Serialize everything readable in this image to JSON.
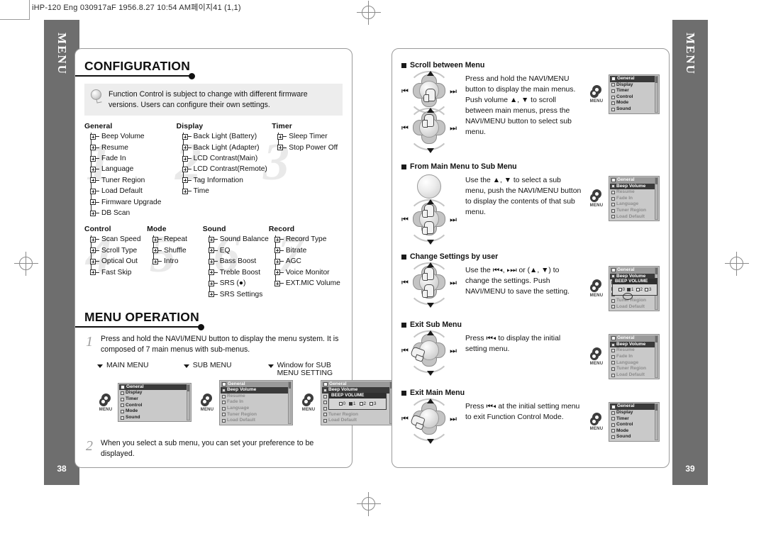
{
  "print_header": "iHP-120 Eng 030917aF  1956.8.27 10:54 AM페이지41 (1,1)",
  "tabs": {
    "left": {
      "label": "MENU",
      "page": "38"
    },
    "right": {
      "label": "MENU",
      "page": "39"
    }
  },
  "left_page": {
    "section1": {
      "title": "CONFIGURATION",
      "tip": "Function Control is subject to change with different firmware versions. Users can configure their own settings.",
      "tree_row1": [
        {
          "head": "General",
          "items": [
            "Beep Volume",
            "Resume",
            "Fade In",
            "Language",
            "Tuner Region",
            "Load Default",
            "Firmware Upgrade",
            "DB  Scan"
          ]
        },
        {
          "head": "Display",
          "items": [
            "Back Light (Battery)",
            "Back Light (Adapter)",
            "LCD Contrast(Main)",
            "LCD Contrast(Remote)",
            "Tag Information",
            "Time"
          ]
        },
        {
          "head": "Timer",
          "items": [
            "Sleep Timer",
            "Stop Power Off"
          ]
        }
      ],
      "tree_row2": [
        {
          "head": "Control",
          "items": [
            "Scan Speed",
            "Scroll Type",
            "Optical Out",
            "Fast Skip"
          ]
        },
        {
          "head": "Mode",
          "items": [
            "Repeat",
            "Shuffle",
            "Intro"
          ]
        },
        {
          "head": "Sound",
          "items": [
            "Sound Balance",
            "EQ",
            "Bass Boost",
            "Treble Boost",
            "SRS (●)",
            "SRS Settings"
          ]
        },
        {
          "head": "Record",
          "items": [
            "Record Type",
            "Bitrate",
            "AGC",
            "Voice Monitor",
            "EXT.MIC Volume"
          ]
        }
      ],
      "watermarks": [
        "1",
        "2",
        "3",
        "4",
        "5",
        "6",
        "7"
      ]
    },
    "section2": {
      "title": "MENU OPERATION",
      "step1_num": "1",
      "step1_text": "Press and hold the NAVI/MENU button to display the menu system. It is composed of 7 main menus with sub-menus.",
      "captions": [
        "MAIN MENU",
        "SUB MENU",
        "Window for SUB MENU SETTING"
      ],
      "step2_num": "2",
      "step2_text": "When you select a sub menu, you can set your preference to be displayed."
    }
  },
  "right_page": {
    "sections": [
      {
        "head": "Scroll between Menu",
        "text": "Press and hold the NAVI/MENU button to display the main menus. Push volume ▲, ▼ to scroll between main menus, press the NAVI/MENU button to select sub menu."
      },
      {
        "head": "From Main Menu to Sub Menu",
        "text": "Use the ▲, ▼ to select a sub menu, push the NAVI/MENU button to display the contents of that sub menu."
      },
      {
        "head": "Change Settings by user",
        "text": "Use the ⏮◂, ▸⏭ or (▲, ▼) to change the settings.  Push NAVI/MENU to save the setting."
      },
      {
        "head": "Exit Sub Menu",
        "text": "Press ⏮◂ to display the initial setting menu."
      },
      {
        "head": "Exit Main Menu",
        "text": "Press ⏮◂ at the initial setting menu to exit Function Control Mode."
      }
    ]
  },
  "lcd": {
    "menu_word": "MENU",
    "main_menu": {
      "title": "General",
      "items": [
        "Display",
        "Timer",
        "Control",
        "Mode",
        "Sound"
      ]
    },
    "sub_menu": {
      "title": "General",
      "highlight": "Beep Volume",
      "items": [
        "Resume",
        "Fade In",
        "Language",
        "Tuner Region",
        "Load Default"
      ]
    },
    "setting_window": {
      "title": "General",
      "highlight": "Beep Volume",
      "popup_title": "BEEP VOLUME",
      "options": [
        "0",
        "1",
        "2",
        "3"
      ],
      "selected": "1",
      "tail_items": [
        "Tuner Region",
        "Load Default"
      ]
    }
  }
}
